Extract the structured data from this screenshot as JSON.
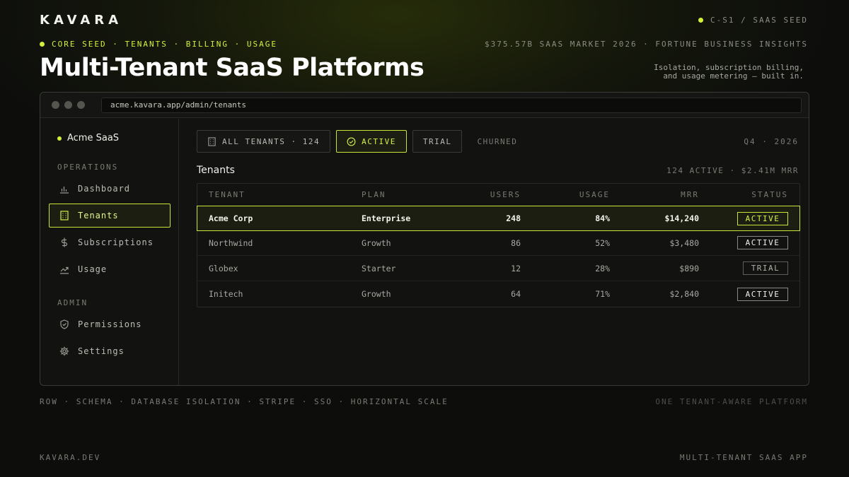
{
  "brand": "KAVARA",
  "top_right": "C-S1 / SAAS SEED",
  "nav_line": "CORE SEED · TENANTS · BILLING · USAGE",
  "market": "$375.57B SAAS MARKET 2026 · FORTUNE BUSINESS INSIGHTS",
  "title": "Multi-Tenant SaaS Platforms",
  "subtitle": "Isolation, subscription billing, and usage metering — built in.",
  "window": {
    "url": "acme.kavara.app/admin/tenants"
  },
  "sidebar": {
    "org_name": "Acme SaaS",
    "section_operations": "OPERATIONS",
    "section_admin": "ADMIN",
    "items": [
      {
        "label": "Dashboard",
        "icon": "bar-chart-icon"
      },
      {
        "label": "Tenants",
        "icon": "building-icon"
      },
      {
        "label": "Subscriptions",
        "icon": "dollar-icon"
      },
      {
        "label": "Usage",
        "icon": "trend-icon"
      },
      {
        "label": "Permissions",
        "icon": "shield-icon"
      },
      {
        "label": "Settings",
        "icon": "gear-icon"
      }
    ]
  },
  "filters": {
    "all": "ALL TENANTS · 124",
    "active": "ACTIVE",
    "trial": "TRIAL",
    "churned": "CHURNED"
  },
  "period": "Q4 · 2026",
  "table": {
    "title": "Tenants",
    "summary": "124 ACTIVE · $2.41M MRR",
    "headers": [
      "TENANT",
      "PLAN",
      "USERS",
      "USAGE",
      "MRR",
      "STATUS"
    ],
    "rows": [
      {
        "tenant": "Acme Corp",
        "plan": "Enterprise",
        "users": "248",
        "usage": "84%",
        "mrr": "$14,240",
        "status": "ACTIVE"
      },
      {
        "tenant": "Northwind",
        "plan": "Growth",
        "users": "86",
        "usage": "52%",
        "mrr": "$3,480",
        "status": "ACTIVE"
      },
      {
        "tenant": "Globex",
        "plan": "Starter",
        "users": "12",
        "usage": "28%",
        "mrr": "$890",
        "status": "TRIAL"
      },
      {
        "tenant": "Initech",
        "plan": "Growth",
        "users": "64",
        "usage": "71%",
        "mrr": "$2,840",
        "status": "ACTIVE"
      }
    ]
  },
  "tags": "ROW · SCHEMA · DATABASE ISOLATION · STRIPE · SSO · HORIZONTAL SCALE",
  "tagline": "ONE TENANT-AWARE PLATFORM",
  "footer_left": "KAVARA.DEV",
  "footer_right": "MULTI-TENANT SAAS APP",
  "colors": {
    "accent": "#d4f03a",
    "background": "#0d0e0c",
    "panel": "#121311"
  }
}
